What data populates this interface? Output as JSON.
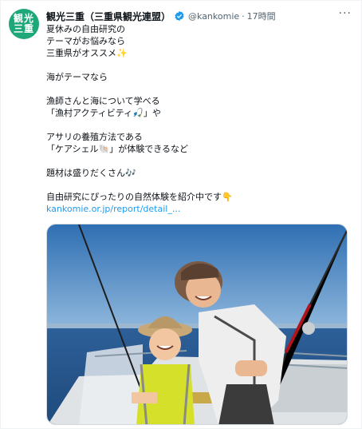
{
  "account": {
    "avatar_line1": "観光",
    "avatar_line2": "三重",
    "display_name": "観光三重（三重県観光連盟）",
    "handle": "@kankomie",
    "separator": "·",
    "time": "17時間",
    "more_label": "···"
  },
  "tweet": {
    "lines": [
      "夏休みの自由研究の",
      "テーマがお悩みなら",
      "三重県がオススメ✨",
      "",
      "海がテーマなら",
      "",
      "漁師さんと海について学べる",
      "「漁村アクティビティ🎣」や",
      "",
      "アサリの養殖方法である",
      "「ケアシェル🐚」が体験できるなど",
      "",
      "題材は盛りだくさん🎶",
      "",
      "自由研究にぴったりの自然体験を紹介中です👇"
    ],
    "link": "kankomie.or.jp/report/detail_..."
  },
  "colors": {
    "verified": "#1d9bf0",
    "avatar_bg": "#1ea87a",
    "link": "#1d9bf0"
  }
}
